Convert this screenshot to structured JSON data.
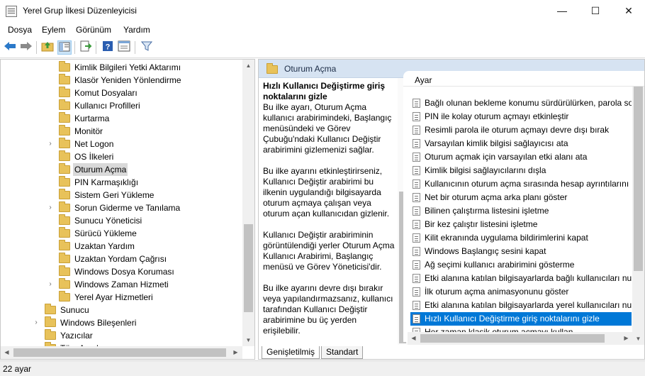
{
  "window": {
    "title": "Yerel Grup İlkesi Düzenleyicisi",
    "minimize": "—",
    "maximize": "☐",
    "close": "✕"
  },
  "menu": [
    "Dosya",
    "Eylem",
    "Görünüm",
    "Yardım"
  ],
  "toolbar": {
    "icons": [
      "back-arrow-icon",
      "forward-arrow-icon",
      "up-folder-icon",
      "show-tree-icon",
      "export-list-icon",
      "help-icon",
      "properties-icon",
      "filter-icon"
    ]
  },
  "tree": {
    "items": [
      {
        "label": "Kimlik Bilgileri Yetki Aktarımı",
        "chevron": ""
      },
      {
        "label": "Klasör Yeniden Yönlendirme",
        "chevron": ""
      },
      {
        "label": "Komut Dosyaları",
        "chevron": ""
      },
      {
        "label": "Kullanıcı Profilleri",
        "chevron": ""
      },
      {
        "label": "Kurtarma",
        "chevron": ""
      },
      {
        "label": "Monitör",
        "chevron": ""
      },
      {
        "label": "Net Logon",
        "chevron": "›"
      },
      {
        "label": "OS İlkeleri",
        "chevron": ""
      },
      {
        "label": "Oturum Açma",
        "chevron": ""
      },
      {
        "label": "PIN Karmaşıklığı",
        "chevron": ""
      },
      {
        "label": "Sistem Geri Yükleme",
        "chevron": ""
      },
      {
        "label": "Sorun Giderme ve Tanılama",
        "chevron": "›"
      },
      {
        "label": "Sunucu Yöneticisi",
        "chevron": ""
      },
      {
        "label": "Sürücü Yükleme",
        "chevron": ""
      },
      {
        "label": "Uzaktan Yardım",
        "chevron": ""
      },
      {
        "label": "Uzaktan Yordam Çağrısı",
        "chevron": ""
      },
      {
        "label": "Windows Dosya Koruması",
        "chevron": ""
      },
      {
        "label": "Windows Zaman Hizmeti",
        "chevron": "›"
      },
      {
        "label": "Yerel Ayar Hizmetleri",
        "chevron": ""
      },
      {
        "label": "Sunucu",
        "chevron": ""
      },
      {
        "label": "Windows Bileşenleri",
        "chevron": "›"
      },
      {
        "label": "Yazıcılar",
        "chevron": ""
      },
      {
        "label": "Tüm Ayarlar",
        "chevron": ""
      }
    ],
    "selected_index": 8
  },
  "right": {
    "header": "Oturum Açma",
    "description": {
      "title": "Hızlı Kullanıcı Değiştirme giriş noktalarını gizle",
      "paragraphs": [
        "Bu ilke ayarı, Oturum Açma kullanıcı arabirimindeki, Başlangıç menüsündeki ve Görev Çubuğu'ndaki Kullanıcı Değiştir arabirimini gizlemenizi sağlar.",
        "Bu ilke ayarını etkinleştirirseniz, Kullanıcı Değiştir arabirimi bu ilkenin uygulandığı bilgisayarda oturum açmaya çalışan veya oturum açan kullanıcıdan gizlenir.",
        "Kullanıcı Değiştir arabiriminin görüntülendiği yerler Oturum Açma Kullanıcı Arabirimi, Başlangıç menüsü ve Görev Yöneticisi'dir.",
        "Bu ilke ayarını devre dışı bırakır veya yapılandırmazsanız, kullanıcı tarafından Kullanıcı Değiştir arabirimine bu üç yerden erişilebilir."
      ]
    },
    "list_header": "Ayar",
    "settings": [
      "Bağlı olunan bekleme konumu sürdürülürken, parola sor",
      "PIN ile kolay oturum açmayı etkinleştir",
      "Resimli parola ile oturum açmayı devre dışı bırak",
      "Varsayılan kimlik bilgisi sağlayıcısı ata",
      "Oturum açmak için varsayılan etki alanı ata",
      "Kimlik bilgisi sağlayıcılarını dışla",
      "Kullanıcının oturum açma sırasında hesap ayrıntılarını gi",
      "Net bir oturum açma arka planı göster",
      "Bilinen çalıştırma listesini işletme",
      "Bir kez çalıştır listesini işletme",
      "Kilit ekranında uygulama bildirimlerini kapat",
      "Windows Başlangıç sesini kapat",
      "Ağ seçimi kullanıcı arabirimini gösterme",
      "Etki alanına katılan bilgisayarlarda bağlı kullanıcıları nur",
      "İlk oturum açma animasyonunu göster",
      "Etki alanına katılan bilgisayarlarda yerel kullanıcıları nur",
      "Hızlı Kullanıcı Değiştirme giriş noktalarını gizle",
      "Her zaman klasik oturum açmayı kullan"
    ],
    "selected_setting_index": 16,
    "tabs": [
      "Genişletilmiş",
      "Standart"
    ]
  },
  "status": "22 ayar",
  "colors": {
    "selection": "#0078d7",
    "header_bg": "#d6e3f2",
    "folder": "#e8c25a"
  }
}
